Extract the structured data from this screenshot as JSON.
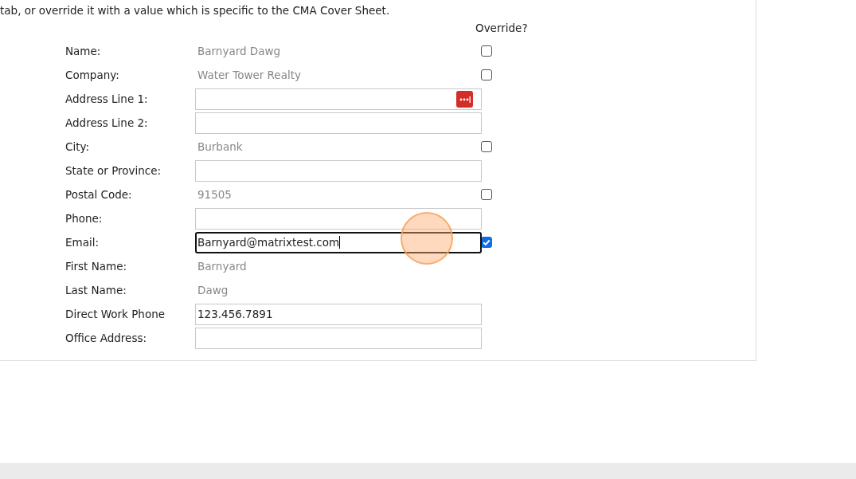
{
  "intro": "tab, or override it with a value which is specific to the CMA Cover Sheet.",
  "override_header": "Override?",
  "rows": [
    {
      "label": "Name:",
      "kind": "static",
      "value": "Barnyard Dawg",
      "override": false
    },
    {
      "label": "Company:",
      "kind": "static",
      "value": "Water Tower Realty",
      "override": false
    },
    {
      "label": "Address Line 1:",
      "kind": "field",
      "value": "",
      "focused": false,
      "autofill_icon": true
    },
    {
      "label": "Address Line 2:",
      "kind": "field",
      "value": "",
      "focused": false
    },
    {
      "label": "City:",
      "kind": "static",
      "value": "Burbank",
      "override": false
    },
    {
      "label": "State or Province:",
      "kind": "field",
      "value": "",
      "focused": false
    },
    {
      "label": "Postal Code:",
      "kind": "static",
      "value": "91505",
      "override": false
    },
    {
      "label": "Phone:",
      "kind": "field",
      "value": "",
      "focused": false
    },
    {
      "label": "Email:",
      "kind": "field",
      "value": "Barnyard@matrixtest.com",
      "focused": true,
      "override": true
    },
    {
      "label": "First Name:",
      "kind": "static",
      "value": "Barnyard"
    },
    {
      "label": "Last Name:",
      "kind": "static",
      "value": "Dawg"
    },
    {
      "label": "Direct Work Phone",
      "kind": "field",
      "value": "123.456.7891",
      "focused": false
    },
    {
      "label": "Office Address:",
      "kind": "field",
      "value": "",
      "focused": false
    }
  ]
}
